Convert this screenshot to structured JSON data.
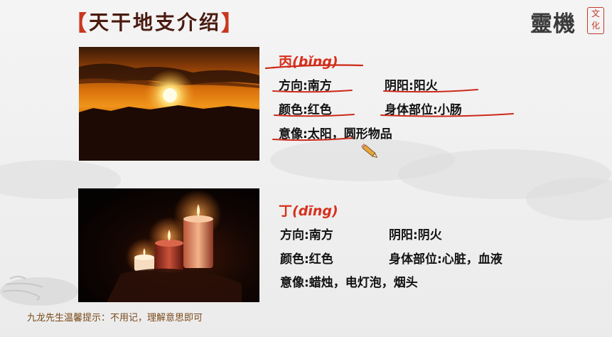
{
  "title": {
    "bracket_left": "【",
    "text": "天干地支介绍",
    "bracket_right": "】"
  },
  "logo": {
    "main": "靈機",
    "sub": "文化"
  },
  "cards": [
    {
      "name": "丙",
      "pinyin": "(bǐng)",
      "direction": "方向:南方",
      "yinyang": "阴阳:阳火",
      "color": "颜色:红色",
      "body": "身体部位:小肠",
      "image": "意像:太阳，圆形物品"
    },
    {
      "name": "丁",
      "pinyin": "(dīng)",
      "direction": "方向:南方",
      "yinyang": "阴阳:阴火",
      "color": "颜色:红色",
      "body": "身体部位:心脏，血液",
      "image": "意像:蜡烛，电灯泡，烟头"
    }
  ],
  "note": "九龙先生温馨提示：不用记，理解意思即可",
  "colors": {
    "accent": "#d8301c",
    "title": "#4a1b0f",
    "annotation": "#cc2a1a"
  }
}
